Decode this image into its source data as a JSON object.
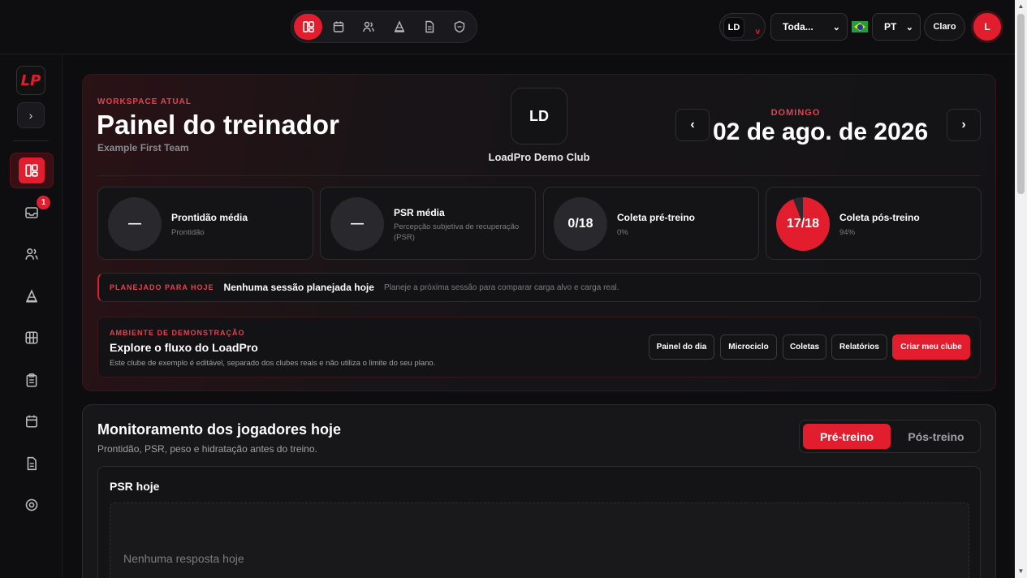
{
  "topbar": {
    "nav": [
      {
        "name": "dashboard-icon",
        "active": true
      },
      {
        "name": "calendar-icon",
        "active": false
      },
      {
        "name": "athletes-icon",
        "active": false
      },
      {
        "name": "cone-icon",
        "active": false
      },
      {
        "name": "document-icon",
        "active": false
      },
      {
        "name": "shield-icon",
        "active": false
      }
    ],
    "club_initials": "LD",
    "club_chevron": "v",
    "team_select": "Toda...",
    "lang_select": "PT",
    "theme_label": "Claro",
    "user_initial": "L"
  },
  "sidebar": {
    "expand_glyph": "›",
    "logo_text": "LP",
    "inbox_badge": "1",
    "items": [
      "dashboard-icon",
      "inbox-icon",
      "athletes-icon",
      "cone-icon",
      "grid-icon",
      "clipboard-icon",
      "calendar-icon",
      "document-icon",
      "settings-icon"
    ]
  },
  "hero": {
    "workspace_label": "WORKSPACE ATUAL",
    "title": "Painel do treinador",
    "team": "Example First Team",
    "club_initials": "LD",
    "club_name": "LoadPro Demo Club",
    "weekday": "DOMINGO",
    "date": "02 de ago. de 2026",
    "prev": "‹",
    "next": "›"
  },
  "stats": [
    {
      "value": "—",
      "title": "Prontidão média",
      "sub": "Prontidão"
    },
    {
      "value": "—",
      "title": "PSR média",
      "sub": "Percepção subjetiva de recuperação (PSR)"
    },
    {
      "value": "0/18",
      "title": "Coleta pré-treino",
      "sub": "0%"
    },
    {
      "value": "17/18",
      "title": "Coleta pós-treino",
      "sub": "94%",
      "fill_percent": 94
    }
  ],
  "plan": {
    "label": "PLANEJADO PARA HOJE",
    "title": "Nenhuma sessão planejada hoje",
    "sub": "Planeje a próxima sessão para comparar carga alvo e carga real."
  },
  "demo": {
    "label": "AMBIENTE DE DEMONSTRAÇÃO",
    "title": "Explore o fluxo do LoadPro",
    "sub": "Este clube de exemplo é editável, separado dos clubes reais e não utiliza o limite do seu plano.",
    "buttons": [
      "Painel do dia",
      "Microciclo",
      "Coletas",
      "Relatórios"
    ],
    "primary": "Criar meu clube"
  },
  "monitor": {
    "title": "Monitoramento dos jogadores hoje",
    "sub": "Prontidão, PSR, peso e hidratação antes do treino.",
    "tab_on": "Pré-treino",
    "tab_off": "Pós-treino",
    "psr_title": "PSR hoje",
    "psr_empty": "Nenhuma resposta hoje"
  },
  "colors": {
    "accent": "#e11d2e",
    "background": "#0d0d10"
  }
}
